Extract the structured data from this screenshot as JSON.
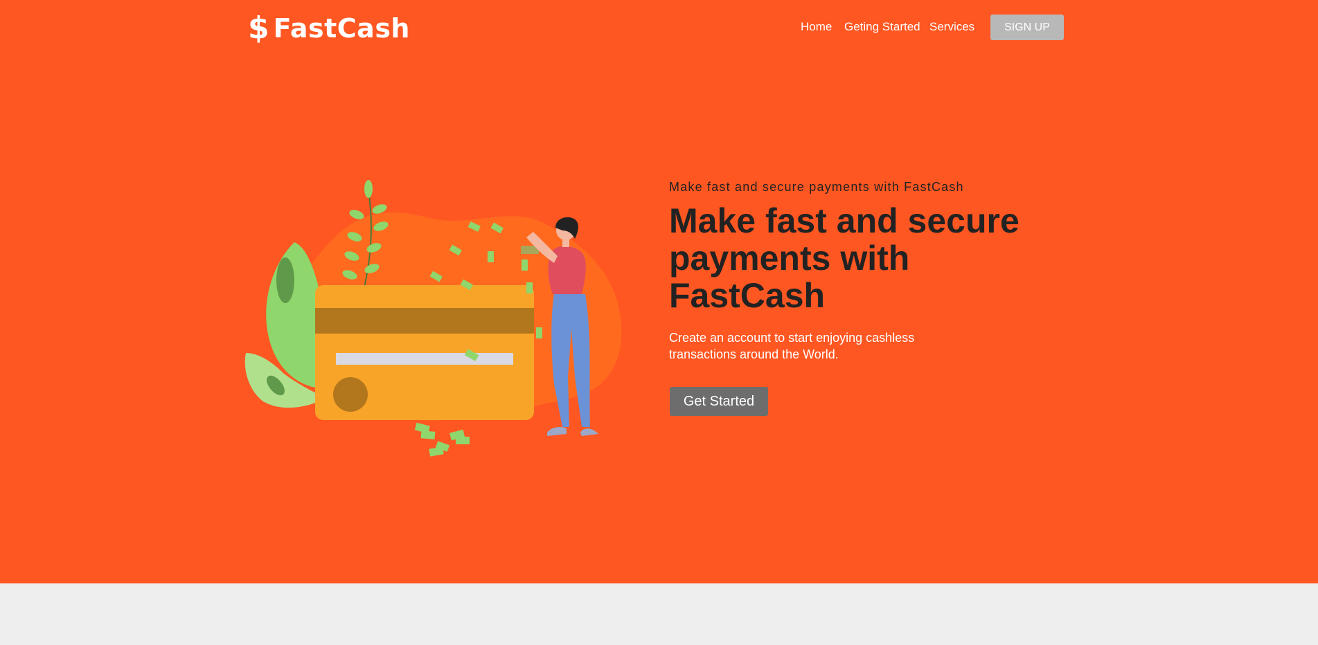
{
  "navbar": {
    "logo_symbol": "$",
    "brand": "FastCash",
    "links": [
      {
        "label": "Home"
      },
      {
        "label": "Geting Started"
      },
      {
        "label": "Services"
      }
    ],
    "signup_label": "SIGN UP"
  },
  "hero": {
    "kicker": "Make fast and secure payments with FastCash",
    "headline": "Make fast and secure payments with FastCash",
    "subtext": "Create an account to start enjoying cashless transactions around the World.",
    "cta_label": "Get Started",
    "illustration": "credit-card-payment-illustration"
  },
  "colors": {
    "hero_background": "#ff5722",
    "page_background": "#eeeeee",
    "signup_button": "#b8b8b8",
    "cta_button": "#6d6d6d",
    "card": "#f7a429",
    "card_stripe": "#b2761c"
  }
}
